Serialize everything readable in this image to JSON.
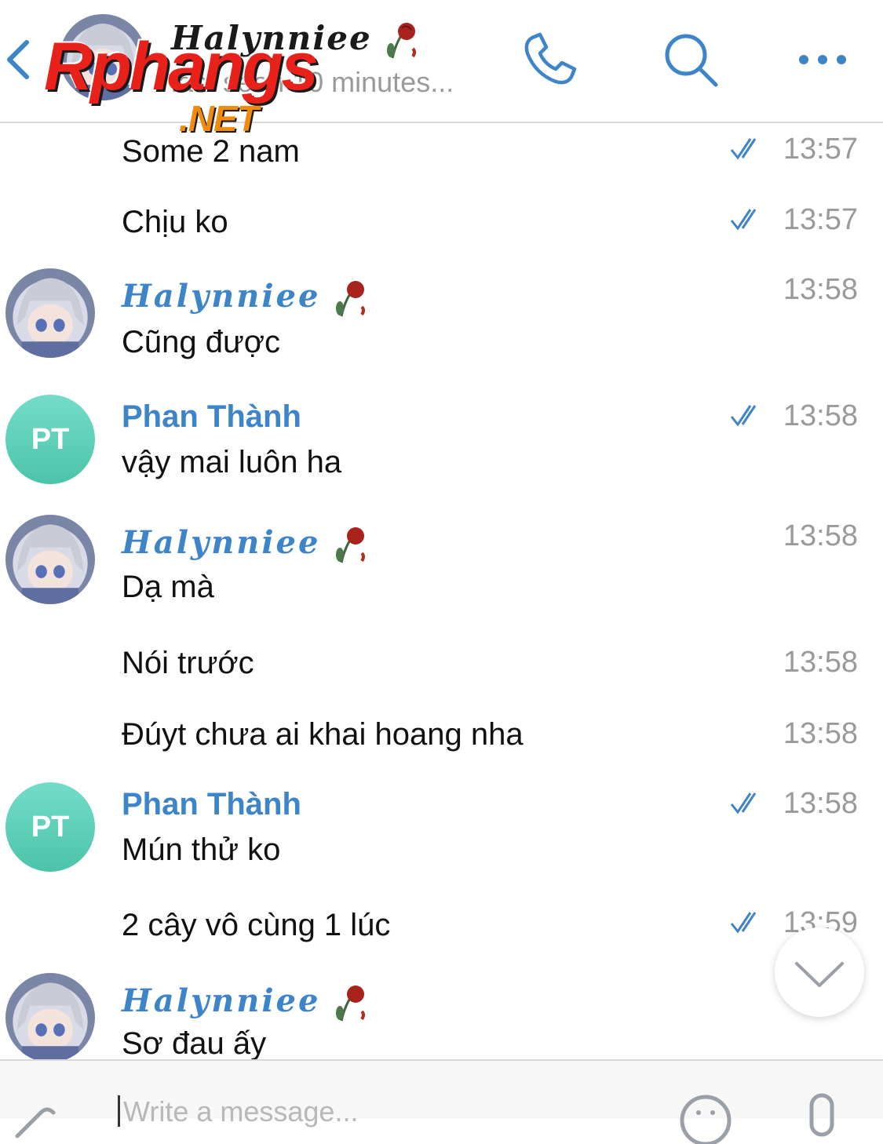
{
  "header": {
    "title": "Halynniee",
    "status": "last seen 10 minutes...",
    "back_icon": "chevron-left-icon",
    "icons": [
      "phone-icon",
      "search-icon",
      "more-icon"
    ]
  },
  "watermark": {
    "main": "Rphangs",
    "sub": ".NET"
  },
  "messages": [
    {
      "sender": "",
      "text": "Some 2 nam",
      "time": "13:57",
      "read": true
    },
    {
      "sender": "",
      "text": "Chịu ko",
      "time": "13:57",
      "read": true
    },
    {
      "sender": "Halynniee",
      "text": "Cũng được",
      "time": "13:58",
      "read": false,
      "avatar": "anime"
    },
    {
      "sender": "Phan Thành",
      "text": "vậy mai luôn ha",
      "time": "13:58",
      "read": true,
      "avatar": "PT"
    },
    {
      "sender": "Halynniee",
      "text": "Dạ mà",
      "time": "13:58",
      "read": false,
      "avatar": "anime"
    },
    {
      "sender": "",
      "text": "Nói trước",
      "time": "13:58",
      "read": false
    },
    {
      "sender": "",
      "text": "Đúyt chưa ai khai hoang nha",
      "time": "13:58",
      "read": false
    },
    {
      "sender": "Phan Thành",
      "text": "Mún thử ko",
      "time": "13:58",
      "read": true,
      "avatar": "PT"
    },
    {
      "sender": "",
      "text": "2 cây vô cùng 1 lúc",
      "time": "13:59",
      "read": true
    },
    {
      "sender": "Halynniee",
      "text": "Sơ đau ấy",
      "time": "",
      "read": false,
      "avatar": "anime"
    }
  ],
  "avatar_initials": "PT",
  "input": {
    "placeholder": "Write a message..."
  },
  "colors": {
    "accent": "#3d84c8",
    "pt_avatar": "#5ccfb6",
    "time": "#9a9a9a"
  }
}
